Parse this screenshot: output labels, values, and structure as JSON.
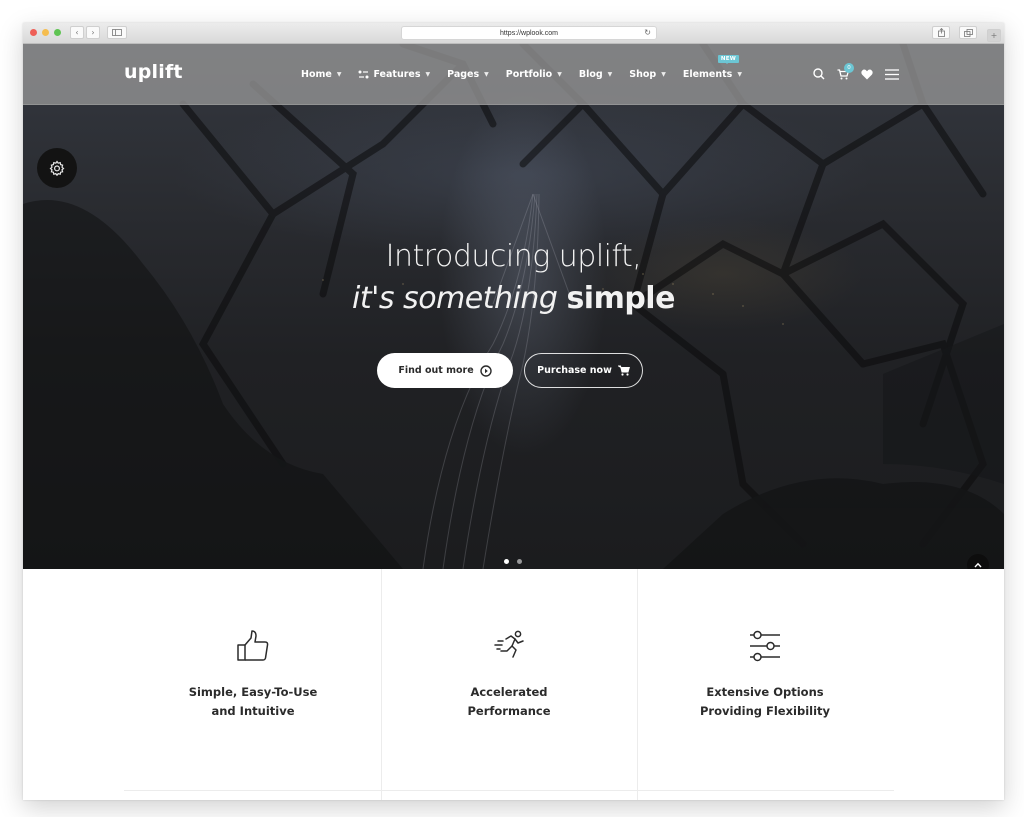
{
  "browser": {
    "url": "https://wplook.com",
    "back_icon": "chevron-left-icon",
    "forward_icon": "chevron-right-icon",
    "sidebar_icon": "sidebar-icon",
    "reload_icon": "reload-icon",
    "share_icon": "share-icon",
    "tabs_icon": "tabs-icon",
    "new_tab_icon": "plus-icon"
  },
  "site": {
    "logo": "uplift",
    "nav": [
      {
        "label": "Home"
      },
      {
        "label": "Features",
        "icon": "features-icon"
      },
      {
        "label": "Pages"
      },
      {
        "label": "Portfolio"
      },
      {
        "label": "Blog"
      },
      {
        "label": "Shop"
      },
      {
        "label": "Elements",
        "badge": "NEW"
      }
    ],
    "cart_count": "0",
    "icons": [
      "search-icon",
      "cart-icon",
      "heart-icon",
      "menu-icon"
    ],
    "accent_color": "#6cc6d4"
  },
  "hero": {
    "line1": "Introducing uplift,",
    "line2_italic": "it's something ",
    "line2_bold": "simple",
    "buttons": {
      "primary": "Find out more",
      "secondary": "Purchase now"
    },
    "slides_total": 2,
    "slide_active": 1
  },
  "features": [
    {
      "icon": "thumbs-up-icon",
      "line1": "Simple, Easy-To-Use",
      "line2": "and Intuitive"
    },
    {
      "icon": "runner-icon",
      "line1": "Accelerated",
      "line2": "Performance"
    },
    {
      "icon": "sliders-icon",
      "line1": "Extensive Options",
      "line2": "Providing Flexibility"
    }
  ]
}
